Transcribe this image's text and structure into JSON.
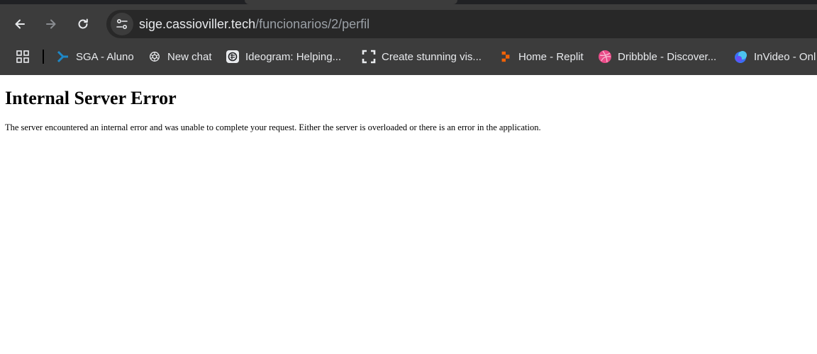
{
  "browser": {
    "url_host": "sige.cassioviller.tech",
    "url_path": "/funcionarios/2/perfil"
  },
  "bookmarks": [
    {
      "label": "SGA - Aluno",
      "icon": "sga-icon"
    },
    {
      "label": "New chat",
      "icon": "openai-icon"
    },
    {
      "label": "Ideogram: Helping...",
      "icon": "ideogram-icon"
    },
    {
      "label": "Create stunning vis...",
      "icon": "frame-icon"
    },
    {
      "label": "Home - Replit",
      "icon": "replit-icon"
    },
    {
      "label": "Dribbble - Discover...",
      "icon": "dribbble-icon"
    },
    {
      "label": "InVideo - Onl",
      "icon": "invideo-icon"
    }
  ],
  "page": {
    "title": "Internal Server Error",
    "message": "The server encountered an internal error and was unable to complete your request. Either the server is overloaded or there is an error in the application."
  },
  "colors": {
    "chrome_bg": "#3c3c3c",
    "omnibox_bg": "#282828",
    "replit_orange": "#f26207",
    "dribbble_pink": "#ea4c89",
    "sga_blue": "#1e88c7"
  }
}
